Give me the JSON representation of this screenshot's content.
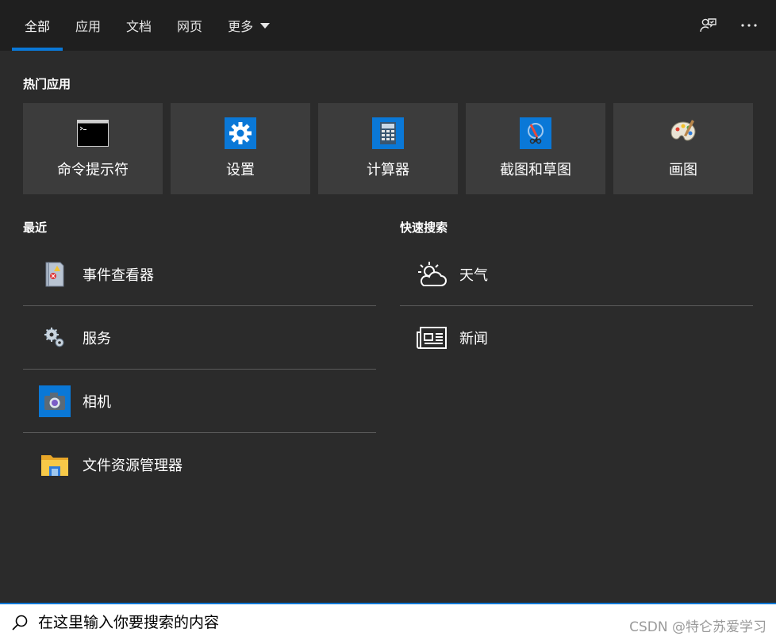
{
  "tabs": [
    {
      "label": "全部",
      "active": true
    },
    {
      "label": "应用",
      "active": false
    },
    {
      "label": "文档",
      "active": false
    },
    {
      "label": "网页",
      "active": false
    },
    {
      "label": "更多",
      "active": false
    }
  ],
  "sections": {
    "top_apps": "热门应用",
    "recent": "最近",
    "quick_search": "快速搜索"
  },
  "top_apps": [
    {
      "label": "命令提示符",
      "icon": "command-prompt-icon"
    },
    {
      "label": "设置",
      "icon": "settings-gear-icon"
    },
    {
      "label": "计算器",
      "icon": "calculator-icon"
    },
    {
      "label": "截图和草图",
      "icon": "snip-sketch-icon"
    },
    {
      "label": "画图",
      "icon": "paint-palette-icon"
    }
  ],
  "recent": [
    {
      "label": "事件查看器",
      "icon": "event-viewer-icon"
    },
    {
      "label": "服务",
      "icon": "services-gears-icon"
    },
    {
      "label": "相机",
      "icon": "camera-icon"
    },
    {
      "label": "文件资源管理器",
      "icon": "file-explorer-folder-icon"
    }
  ],
  "quick_search": [
    {
      "label": "天气",
      "icon": "weather-icon"
    },
    {
      "label": "新闻",
      "icon": "news-icon"
    }
  ],
  "search": {
    "placeholder": "在这里输入你要搜索的内容",
    "watermark": "CSDN @特仑苏爱学习"
  },
  "colors": {
    "accent": "#0a78d7",
    "background": "#2b2b2b",
    "tile": "#3c3c3c"
  }
}
